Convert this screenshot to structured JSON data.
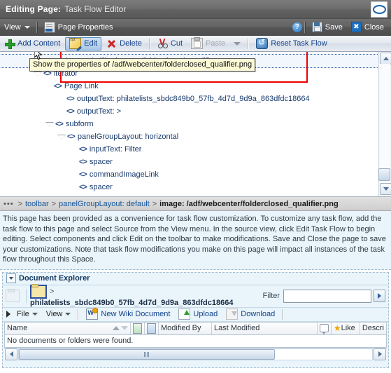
{
  "titlebar": {
    "prefix": "Editing Page:",
    "page_name": "Task Flow Editor",
    "logo_icon": "oracle-logo-icon"
  },
  "menubar": {
    "view_label": "View",
    "page_properties_label": "Page Properties",
    "help_icon": "help-icon",
    "save_label": "Save",
    "close_label": "Close"
  },
  "toolbar": {
    "items": [
      {
        "label": "Add Content",
        "icon": "plus-icon",
        "state": "enabled"
      },
      {
        "label": "Edit",
        "icon": "edit-pencil-icon",
        "state": "selected"
      },
      {
        "label": "Delete",
        "icon": "red-x-icon",
        "state": "enabled"
      },
      {
        "label": "Cut",
        "icon": "scissors-icon",
        "state": "enabled"
      },
      {
        "label": "Paste",
        "icon": "clipboard-icon",
        "state": "disabled"
      },
      {
        "label": "Reset Task Flow",
        "icon": "reset-arrow-icon",
        "state": "enabled"
      }
    ]
  },
  "tooltip": {
    "text": "Show the properties of /adf/webcenter/folderclosed_qualifier.png"
  },
  "tree": {
    "rows": [
      {
        "indent": 3,
        "toggle": "none",
        "label": "image: /adf/webcenter/folderclosed_qualifier.png",
        "focused": true
      },
      {
        "indent": 2,
        "toggle": "open",
        "label": "iterator",
        "focused": false
      },
      {
        "indent": 3,
        "toggle": "none",
        "label": "Page Link",
        "focused": false
      },
      {
        "indent": 2,
        "toggle": "none",
        "label": "outputText: philatelists_sbdc849b0_57fb_4d7d_9d9a_863dfdc18664",
        "focused": false
      },
      {
        "indent": 2,
        "toggle": "none",
        "label": "outputText: >",
        "focused": false
      },
      {
        "indent": 1,
        "toggle": "open",
        "label": "subform",
        "focused": false
      },
      {
        "indent": 2,
        "toggle": "open",
        "label": "panelGroupLayout: horizontal",
        "focused": false
      },
      {
        "indent": 3,
        "toggle": "none",
        "label": "inputText: Filter",
        "focused": false
      },
      {
        "indent": 3,
        "toggle": "none",
        "label": "spacer",
        "focused": false
      },
      {
        "indent": 3,
        "toggle": "none",
        "label": "commandImageLink",
        "focused": false
      },
      {
        "indent": 3,
        "toggle": "none",
        "label": "spacer",
        "focused": false
      }
    ],
    "scrollbar": {
      "up_icon": "scroll-up-icon",
      "down_icon": "scroll-down-icon"
    }
  },
  "breadcrumb": {
    "ellipsis": "•••",
    "separator": ">",
    "links": [
      "toolbar",
      "panelGroupLayout: default"
    ],
    "current": "image: /adf/webcenter/folderclosed_qualifier.png"
  },
  "info": {
    "text": "This page has been provided as a convenience for task flow customization. To customize any task flow, add the task flow to this page and select Source from the View menu. In the source view, click Edit Task Flow to begin editing. Select components and click Edit on the toolbar to make modifications. Save and Close the page to save your customizations. Note that task flow modifications you make on this page will impact all instances of the task flow throughout this Space."
  },
  "document_explorer": {
    "title": "Document Explorer",
    "disclosure_icon": "collapse-chevron-icon",
    "up_folder_icon": "up-one-folder-icon",
    "folder_icon": "folder-icon",
    "path_separator": ">",
    "current_folder": "philatelists_sbdc849b0_57fb_4d7d_9d9a_863dfdc18664",
    "filter_label": "Filter",
    "filter_value": "",
    "filter_placeholder": "",
    "go_icon": "go-arrow-icon",
    "toolbar": [
      {
        "label": "File",
        "icon": "menu-caret-icon",
        "state": "enabled"
      },
      {
        "label": "View",
        "icon": "menu-caret-icon",
        "state": "enabled"
      },
      {
        "label": "New Wiki Document",
        "icon": "wiki-document-icon",
        "state": "enabled"
      },
      {
        "label": "Upload",
        "icon": "upload-icon",
        "state": "enabled"
      },
      {
        "label": "Download",
        "icon": "download-icon",
        "state": "disabled"
      }
    ],
    "table": {
      "columns": [
        {
          "label": "Name",
          "icon": "sort-arrows-icon"
        },
        {
          "label": "",
          "icon": "download-status-icon"
        },
        {
          "label": "",
          "icon": "lock-status-icon"
        },
        {
          "label": "Modified By",
          "icon": ""
        },
        {
          "label": "Last Modified",
          "icon": ""
        },
        {
          "label": "",
          "icon": "comment-icon"
        },
        {
          "label": "Like",
          "icon": "star-icon"
        },
        {
          "label": "Descri",
          "icon": ""
        }
      ],
      "empty_message": "No documents or folders were found.",
      "rows": []
    },
    "hscroll": {
      "left_icon": "scroll-left-icon",
      "right_icon": "scroll-right-icon"
    }
  },
  "colors": {
    "accent_link": "#14428a",
    "title_bar": "#636363",
    "info_bg": "#e9f4fb",
    "annotation": "#ee0000",
    "tooltip_bg": "#fbf9d6"
  }
}
